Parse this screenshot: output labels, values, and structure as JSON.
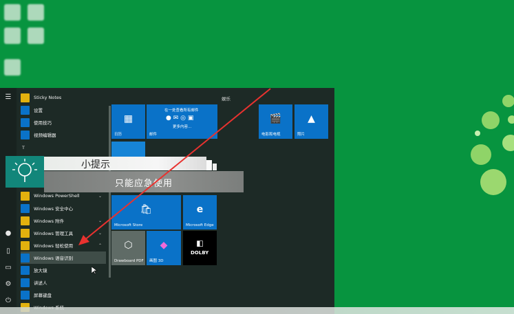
{
  "applist": {
    "items": [
      {
        "label": "Sticky Notes",
        "color": "#e2b10e"
      },
      {
        "label": "设置",
        "color": "#0a72c8"
      },
      {
        "label": "使用技巧",
        "color": "#0a72c8"
      },
      {
        "label": "视频编辑器",
        "color": "#0a72c8"
      }
    ],
    "letter_t": "T",
    "items2": [
      {
        "label": "Windows PowerShell",
        "color": "#e2b10e"
      },
      {
        "label": "Windows 安全中心",
        "color": "#0a72c8"
      },
      {
        "label": "Windows 附件",
        "color": "#e2b10e"
      },
      {
        "label": "Windows 管理工具",
        "color": "#e2b10e"
      },
      {
        "label": "Windows 轻松使用",
        "color": "#e2b10e"
      },
      {
        "label": "Windows 语音识别",
        "color": "#0a72c8"
      },
      {
        "label": "放大镜",
        "color": "#0a72c8"
      },
      {
        "label": "讲述人",
        "color": "#0a72c8"
      },
      {
        "label": "屏幕键盘",
        "color": "#0a72c8"
      },
      {
        "label": "Windows 系统",
        "color": "#e2b10e"
      }
    ]
  },
  "tiles": {
    "group_label": "娱乐",
    "calendar": "日历",
    "mail_header": "在一处查看所有邮件",
    "mail_more": "更多内容...",
    "mail": "邮件",
    "store": "Microsoft Store",
    "edge": "Microsoft Edge",
    "drawboard": "Drawboard PDF",
    "paint3d": "画图 3D",
    "dolby": "DOLBY",
    "movies": "电影和电视",
    "photos": "照片"
  },
  "tip": {
    "title": "小提示",
    "body": "只能应急使用"
  },
  "colors": {
    "desktop": "#07943f",
    "start_bg": "#1d2a26",
    "tile_blue": "#0a72c8",
    "arrow": "#e8322f"
  }
}
